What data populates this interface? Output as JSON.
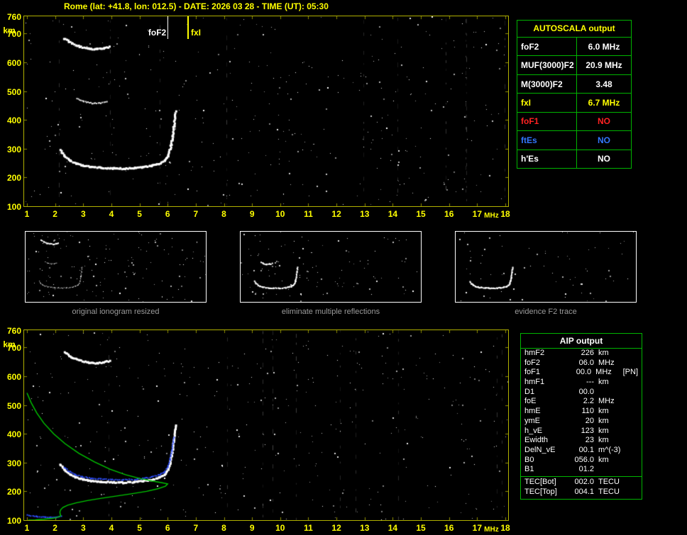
{
  "title": "Rome (lat: +41.8, lon: 012.5) - DATE: 2026 03 28 - TIME (UT): 05:30",
  "colors": {
    "background": "#000000",
    "axis_yellow": "#ffff00",
    "plot_border": "#b0b000",
    "table_green": "#00b400",
    "trace_white": "#ffffff",
    "profile_green": "#00c800",
    "trace_blue": "#2f4fff",
    "no_red": "#ff2222",
    "es_blue": "#3377ff",
    "caption_gray": "#9a9a9a"
  },
  "autoscala_table": {
    "title": "AUTOSCALA output",
    "rows": [
      {
        "param": "foF2",
        "value": "6.0 MHz",
        "color": "#ffffff"
      },
      {
        "param": "MUF(3000)F2",
        "value": "20.9 MHz",
        "color": "#ffffff"
      },
      {
        "param": "M(3000)F2",
        "value": "3.48",
        "color": "#ffffff"
      },
      {
        "param": "fxI",
        "value": "6.7 MHz",
        "color": "#ffff00"
      },
      {
        "param": "foF1",
        "value": "NO",
        "color": "#ff2222"
      },
      {
        "param": "ftEs",
        "value": "NO",
        "color": "#3377ff"
      },
      {
        "param": "h'Es",
        "value": "NO",
        "color": "#ffffff"
      }
    ]
  },
  "thumbnails": [
    {
      "caption": "original ionogram resized"
    },
    {
      "caption": "eliminate multiple reflections"
    },
    {
      "caption": "evidence F2 trace"
    }
  ],
  "aip_table": {
    "title": "AIP output",
    "rows": [
      {
        "param": "hmF2",
        "value": "226",
        "unit": "km",
        "extra": ""
      },
      {
        "param": "foF2",
        "value": "06.0",
        "unit": "MHz",
        "extra": ""
      },
      {
        "param": "foF1",
        "value": "00.0",
        "unit": "MHz",
        "extra": "[PN]"
      },
      {
        "param": "hmF1",
        "value": "---",
        "unit": "km",
        "extra": ""
      },
      {
        "param": "D1",
        "value": "00.0",
        "unit": "",
        "extra": ""
      },
      {
        "param": "foE",
        "value": "2.2",
        "unit": "MHz",
        "extra": ""
      },
      {
        "param": "hmE",
        "value": "110",
        "unit": "km",
        "extra": ""
      },
      {
        "param": "ymE",
        "value": "20",
        "unit": "km",
        "extra": ""
      },
      {
        "param": "h_vE",
        "value": "123",
        "unit": "km",
        "extra": ""
      },
      {
        "param": "Ewidth",
        "value": "23",
        "unit": "km",
        "extra": ""
      },
      {
        "param": "DelN_vE",
        "value": "00.1",
        "unit": "m^(-3)",
        "extra": ""
      },
      {
        "param": "B0",
        "value": "056.0",
        "unit": "km",
        "extra": ""
      },
      {
        "param": "B1",
        "value": "01.2",
        "unit": "",
        "extra": ""
      }
    ],
    "tec_rows": [
      {
        "param": "TEC[Bot]",
        "value": "002.0",
        "unit": "TECU"
      },
      {
        "param": "TEC[Top]",
        "value": "004.1",
        "unit": "TECU"
      }
    ]
  },
  "chart_data": {
    "type": "scatter",
    "description": "Vertical-incidence ionogram: echo virtual height (km) vs sounding frequency (MHz); bottom panel adds restored trace (blue) and electron density profile (green)",
    "axes": {
      "x_unit": "MHz",
      "y_unit": "km",
      "xlim": [
        1,
        18
      ],
      "ylim": [
        100,
        760
      ],
      "x_ticks": [
        1,
        2,
        3,
        4,
        5,
        6,
        7,
        8,
        9,
        10,
        11,
        12,
        13,
        14,
        15,
        16,
        17,
        18
      ],
      "y_ticks": [
        760,
        700,
        600,
        500,
        400,
        300,
        200,
        100
      ]
    },
    "top_plot_markers": [
      {
        "label": "foF2",
        "freq_mhz": 6.0,
        "color": "#ffffff"
      },
      {
        "label": "fxI",
        "freq_mhz": 6.7,
        "color": "#ffff00"
      }
    ],
    "traces": {
      "f2_virtual_height_km": [
        [
          2.15,
          298
        ],
        [
          2.3,
          278
        ],
        [
          2.5,
          262
        ],
        [
          2.7,
          252
        ],
        [
          2.95,
          245
        ],
        [
          3.25,
          240
        ],
        [
          3.6,
          237
        ],
        [
          4.0,
          235
        ],
        [
          4.4,
          234
        ],
        [
          4.8,
          236
        ],
        [
          5.1,
          239
        ],
        [
          5.4,
          244
        ],
        [
          5.65,
          251
        ],
        [
          5.85,
          261
        ],
        [
          5.98,
          278
        ],
        [
          6.06,
          303
        ],
        [
          6.13,
          338
        ],
        [
          6.19,
          382
        ],
        [
          6.25,
          432
        ]
      ],
      "multiple_echo_high_km": [
        [
          2.3,
          686
        ],
        [
          2.55,
          670
        ],
        [
          2.85,
          658
        ],
        [
          3.15,
          651
        ],
        [
          3.45,
          649
        ],
        [
          3.7,
          652
        ],
        [
          3.9,
          657
        ]
      ],
      "multiple_echo_mid_km": [
        [
          2.75,
          477
        ],
        [
          3.0,
          466
        ],
        [
          3.3,
          460
        ],
        [
          3.6,
          461
        ],
        [
          3.82,
          466
        ]
      ],
      "restored_f2_trace_km": [
        [
          2.3,
          286
        ],
        [
          2.5,
          270
        ],
        [
          2.7,
          260
        ],
        [
          2.95,
          253
        ],
        [
          3.25,
          248
        ],
        [
          3.6,
          245
        ],
        [
          4.0,
          243
        ],
        [
          4.4,
          242
        ],
        [
          4.8,
          244
        ],
        [
          5.1,
          247
        ],
        [
          5.4,
          252
        ],
        [
          5.65,
          259
        ],
        [
          5.85,
          269
        ],
        [
          5.98,
          286
        ],
        [
          6.06,
          311
        ],
        [
          6.13,
          346
        ],
        [
          6.19,
          390
        ]
      ],
      "e_region_trace_km": [
        [
          1.0,
          120
        ],
        [
          1.3,
          115
        ],
        [
          1.65,
          112
        ],
        [
          2.0,
          112
        ],
        [
          2.2,
          115
        ]
      ],
      "electron_density_profile_km": [
        [
          1.0,
          542
        ],
        [
          1.15,
          508
        ],
        [
          1.35,
          472
        ],
        [
          1.6,
          437
        ],
        [
          1.95,
          400
        ],
        [
          2.35,
          366
        ],
        [
          2.85,
          332
        ],
        [
          3.4,
          302
        ],
        [
          3.95,
          277
        ],
        [
          4.5,
          258
        ],
        [
          5.0,
          245
        ],
        [
          5.45,
          236
        ],
        [
          5.8,
          230
        ],
        [
          6.0,
          226
        ],
        [
          5.92,
          218
        ],
        [
          5.65,
          209
        ],
        [
          5.25,
          200
        ],
        [
          4.75,
          192
        ],
        [
          4.2,
          184
        ],
        [
          3.65,
          176
        ],
        [
          3.15,
          168
        ],
        [
          2.75,
          160
        ],
        [
          2.45,
          152
        ],
        [
          2.28,
          144
        ],
        [
          2.2,
          136
        ],
        [
          2.17,
          128
        ],
        [
          2.18,
          121
        ],
        [
          2.2,
          115
        ],
        [
          2.1,
          110
        ],
        [
          1.9,
          106
        ],
        [
          1.6,
          103
        ],
        [
          1.3,
          101
        ],
        [
          1.05,
          100
        ]
      ]
    }
  }
}
